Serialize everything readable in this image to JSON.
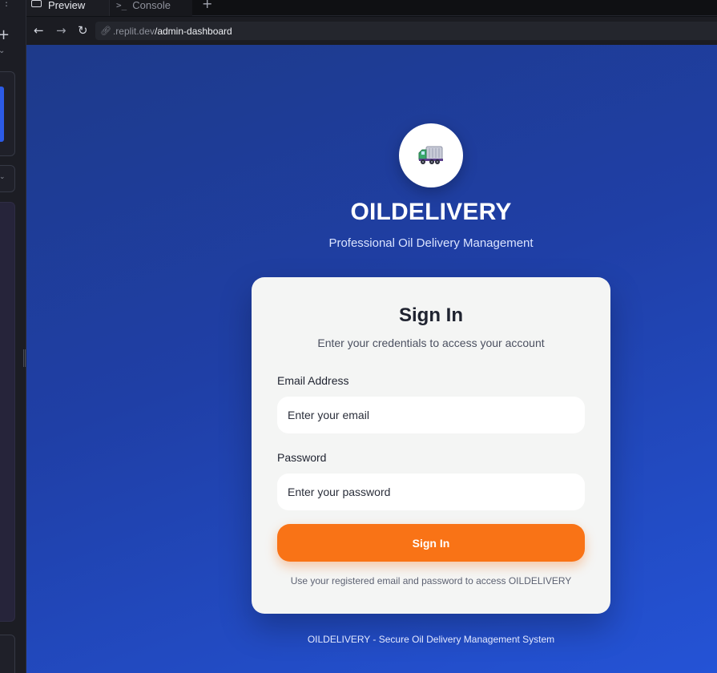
{
  "tabs": {
    "preview_label": "Preview",
    "console_label": "Console",
    "add_icon": "plus-icon"
  },
  "browser": {
    "url_domain": ".replit.dev",
    "url_path": "/admin-dashboard"
  },
  "app": {
    "logo_icon": "truck-icon",
    "brand": "OILDELIVERY",
    "tagline": "Professional Oil Delivery Management",
    "footer": "OILDELIVERY - Secure Oil Delivery Management System"
  },
  "signin": {
    "title": "Sign In",
    "subtitle": "Enter your credentials to access your account",
    "email_label": "Email Address",
    "email_placeholder": "Enter your email",
    "password_label": "Password",
    "password_placeholder": "Enter your password",
    "button_label": "Sign In",
    "hint": "Use your registered email and password to access OILDELIVERY"
  },
  "colors": {
    "accent": "#f97316",
    "background_start": "#1e3a8a",
    "background_end": "#2453d6"
  }
}
